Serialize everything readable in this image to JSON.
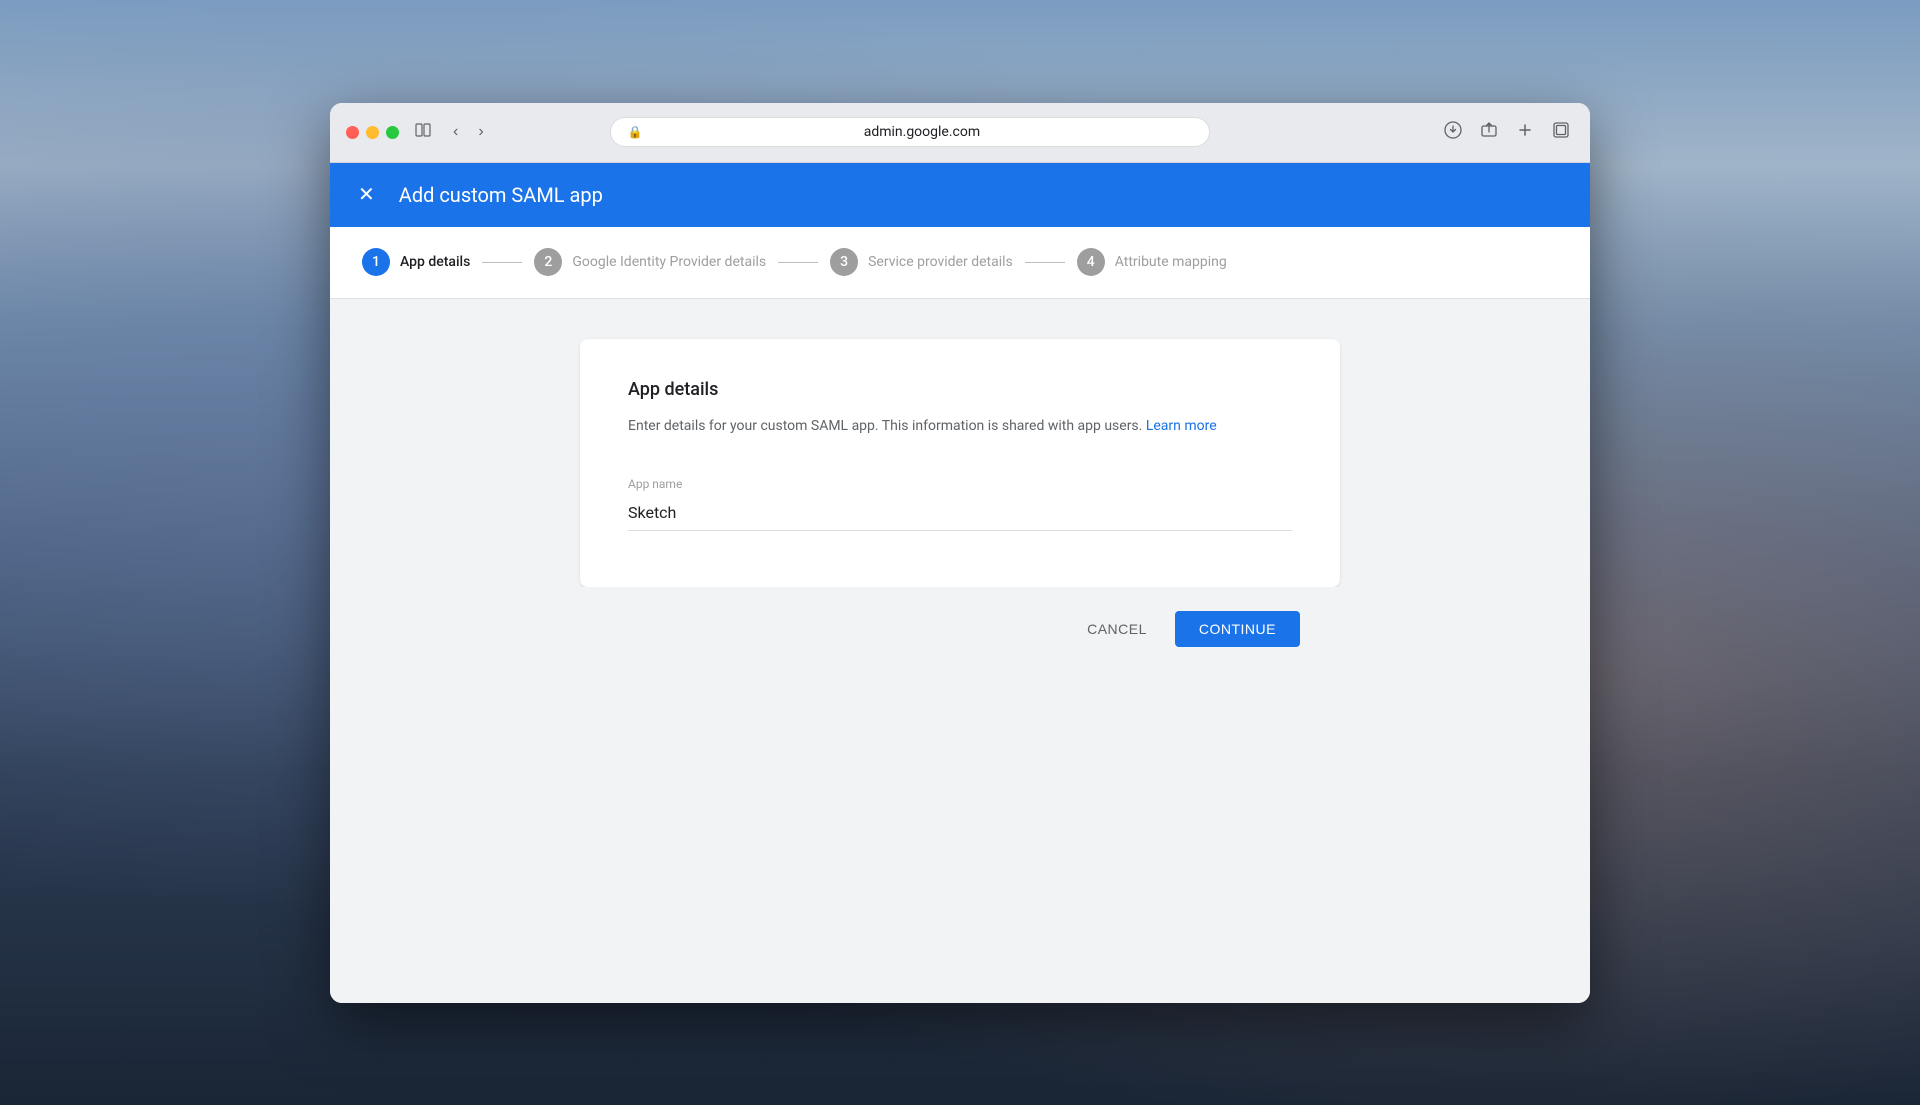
{
  "browser": {
    "url": "admin.google.com",
    "traffic_lights": {
      "close": "close",
      "minimize": "minimize",
      "maximize": "maximize"
    }
  },
  "header": {
    "title": "Add custom SAML app",
    "close_icon": "×"
  },
  "stepper": {
    "steps": [
      {
        "number": "1",
        "label": "App details",
        "state": "active"
      },
      {
        "number": "2",
        "label": "Google Identity Provider details",
        "state": "inactive"
      },
      {
        "number": "3",
        "label": "Service provider details",
        "state": "inactive"
      },
      {
        "number": "4",
        "label": "Attribute mapping",
        "state": "inactive"
      }
    ]
  },
  "card": {
    "title": "App details",
    "description": "Enter details for your custom SAML app. This information is shared with app users.",
    "learn_more_label": "Learn more",
    "form": {
      "app_name_label": "App name",
      "app_name_value": "Sketch"
    }
  },
  "actions": {
    "cancel_label": "CANCEL",
    "continue_label": "CONTINUE"
  }
}
